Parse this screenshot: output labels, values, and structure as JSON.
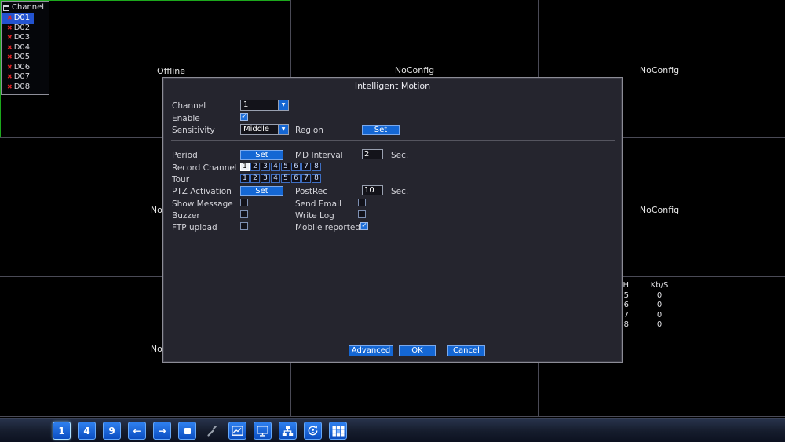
{
  "colors": {
    "accent_blue": "#1467d4",
    "selected_cell_green": "#1ca81c",
    "offline_x_red": "#e02525",
    "selected_channel_bg": "#2353d0"
  },
  "channel_panel": {
    "title": "Channel",
    "items": [
      {
        "label": "D01",
        "selected": true
      },
      {
        "label": "D02",
        "selected": false
      },
      {
        "label": "D03",
        "selected": false
      },
      {
        "label": "D04",
        "selected": false
      },
      {
        "label": "D05",
        "selected": false
      },
      {
        "label": "D06",
        "selected": false
      },
      {
        "label": "D07",
        "selected": false
      },
      {
        "label": "D08",
        "selected": false
      }
    ]
  },
  "grid": {
    "offline_label": "Offline",
    "noconfig_label": "NoConfig"
  },
  "bitrate": {
    "col_ch": "CH",
    "col_kbs": "Kb/S",
    "rows": [
      {
        "ch": "5",
        "kbs": "0"
      },
      {
        "ch": "6",
        "kbs": "0"
      },
      {
        "ch": "7",
        "kbs": "0"
      },
      {
        "ch": "8",
        "kbs": "0"
      }
    ]
  },
  "dialog": {
    "title": "Intelligent Motion",
    "channel_label": "Channel",
    "channel_value": "1",
    "enable_label": "Enable",
    "enable_checked": true,
    "sensitivity_label": "Sensitivity",
    "sensitivity_value": "Middle",
    "region_label": "Region",
    "region_set": "Set",
    "period_label": "Period",
    "period_set": "Set",
    "md_interval_label": "MD Interval",
    "md_interval_value": "2",
    "md_interval_unit": "Sec.",
    "record_channel_label": "Record Channel",
    "record_channel_selected": [
      "1"
    ],
    "tour_label": "Tour",
    "channel_numbers": [
      "1",
      "2",
      "3",
      "4",
      "5",
      "6",
      "7",
      "8"
    ],
    "ptz_label": "PTZ Activation",
    "ptz_set": "Set",
    "postrec_label": "PostRec",
    "postrec_value": "10",
    "postrec_unit": "Sec.",
    "show_message_label": "Show Message",
    "show_message_checked": false,
    "send_email_label": "Send Email",
    "send_email_checked": false,
    "buzzer_label": "Buzzer",
    "buzzer_checked": false,
    "write_log_label": "Write Log",
    "write_log_checked": false,
    "ftp_label": "FTP upload",
    "ftp_checked": false,
    "mobile_label": "Mobile reported",
    "mobile_checked": true,
    "advanced_button": "Advanced",
    "ok_button": "OK",
    "cancel_button": "Cancel"
  },
  "taskbar": {
    "view_single": "1",
    "view_quad": "4",
    "view_nine": "9",
    "prev_icon": "←",
    "next_icon": "→"
  }
}
